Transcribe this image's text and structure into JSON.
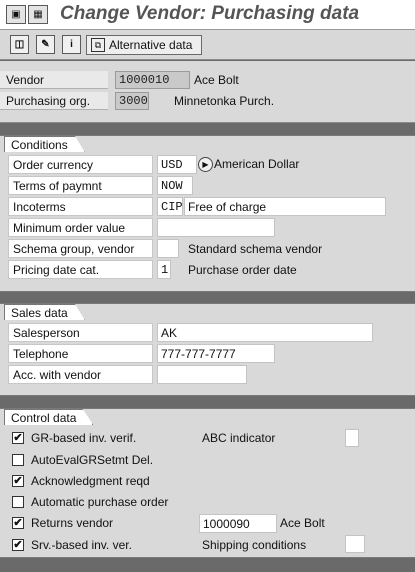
{
  "window": {
    "title": "Change Vendor: Purchasing data"
  },
  "titlebar_icons": [
    "menu-icon",
    "system-menu-icon"
  ],
  "toolbar": {
    "icons": [
      "other-object-icon",
      "display-change-icon",
      "info-icon"
    ],
    "alternative_data_label": "Alternative data"
  },
  "header": {
    "vendor_label": "Vendor",
    "vendor_value": "1000010",
    "vendor_name": "Ace Bolt",
    "purch_org_label": "Purchasing org.",
    "purch_org_value": "3000",
    "purch_org_name": "Minnetonka Purch."
  },
  "conditions": {
    "title": "Conditions",
    "order_currency_label": "Order currency",
    "order_currency_value": "USD",
    "order_currency_desc": "American Dollar",
    "terms_label": "Terms of paymnt",
    "terms_value": "NOW",
    "incoterms_label": "Incoterms",
    "incoterms_value": "CIP",
    "incoterms_desc": "Free of charge",
    "min_order_label": "Minimum order value",
    "min_order_value": "",
    "schema_label": "Schema group, vendor",
    "schema_value": "",
    "schema_desc": "Standard schema vendor",
    "pricing_label": "Pricing date cat.",
    "pricing_value": "1",
    "pricing_desc": "Purchase order date"
  },
  "sales": {
    "title": "Sales data",
    "salesperson_label": "Salesperson",
    "salesperson_value": "AK",
    "telephone_label": "Telephone",
    "telephone_value": "777-777-7777",
    "acc_label": "Acc. with vendor",
    "acc_value": ""
  },
  "control": {
    "title": "Control data",
    "gr_label": "GR-based inv. verif.",
    "gr_checked": true,
    "abc_label": "ABC indicator",
    "autoeval_label": "AutoEvalGRSetmt Del.",
    "autoeval_checked": false,
    "ack_label": "Acknowledgment reqd",
    "ack_checked": true,
    "auto_po_label": "Automatic purchase order",
    "auto_po_checked": false,
    "returns_label": "Returns vendor",
    "returns_checked": true,
    "returns_value": "1000090",
    "returns_name": "Ace Bolt",
    "srv_label": "Srv.-based inv. ver.",
    "srv_checked": true,
    "shipping_label": "Shipping conditions"
  }
}
